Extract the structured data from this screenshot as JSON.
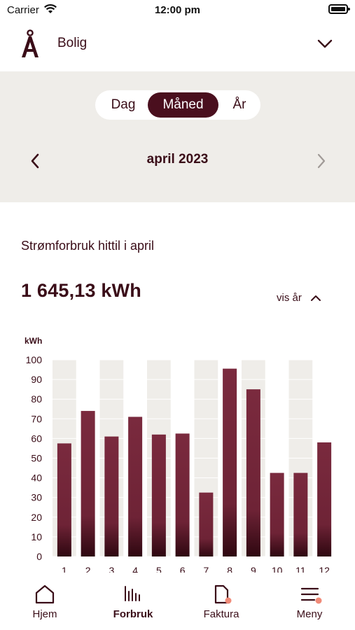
{
  "status_bar": {
    "carrier": "Carrier",
    "time": "12:00 pm"
  },
  "header": {
    "title": "Bolig"
  },
  "period_selector": {
    "options": [
      "Dag",
      "Måned",
      "År"
    ],
    "selected": "Måned",
    "period": "april 2023"
  },
  "usage": {
    "title": "Strømforbruk hittil i april",
    "total": "1 645,13 kWh",
    "toggle_label": "vis år"
  },
  "chart_data": {
    "type": "bar",
    "ylabel": "kWh",
    "ylim": [
      0,
      100
    ],
    "yticks": [
      0,
      10,
      20,
      30,
      40,
      50,
      60,
      70,
      80,
      90,
      100
    ],
    "categories": [
      "1",
      "2",
      "3",
      "4",
      "5",
      "6",
      "7",
      "8",
      "9",
      "10",
      "11",
      "12"
    ],
    "values": [
      57.5,
      74,
      61,
      71,
      62,
      62.5,
      32.5,
      95.5,
      85,
      42.5,
      42.5,
      58
    ],
    "grid": true,
    "bar_color": "#7a2a3e",
    "bar_color_bottom": "#3b0a16",
    "column_band_color": "#efede9"
  },
  "tabbar": {
    "tabs": [
      {
        "label": "Hjem",
        "icon": "home-icon",
        "active": false,
        "badge": false
      },
      {
        "label": "Forbruk",
        "icon": "bar-chart-icon",
        "active": true,
        "badge": false
      },
      {
        "label": "Faktura",
        "icon": "document-icon",
        "active": false,
        "badge": true
      },
      {
        "label": "Meny",
        "icon": "menu-icon",
        "active": false,
        "badge": true
      }
    ]
  },
  "colors": {
    "primary": "#4a0f1e",
    "text": "#3a0d18",
    "panel_bg": "#efede9",
    "badge": "#f08a78"
  }
}
